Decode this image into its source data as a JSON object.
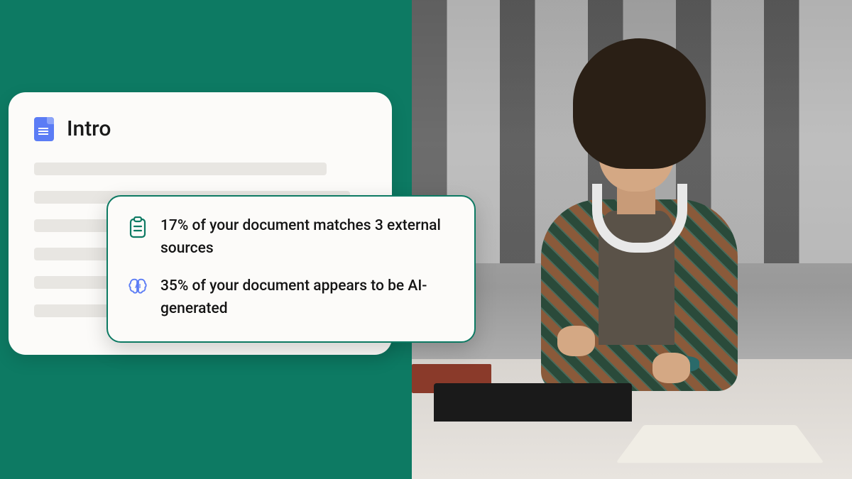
{
  "document": {
    "title": "Intro"
  },
  "report": {
    "plagiarism": {
      "text": "17% of your document matches 3 external sources",
      "percent": 17,
      "source_count": 3
    },
    "ai": {
      "text": "35% of your document appears to be AI-generated",
      "percent": 35
    }
  },
  "colors": {
    "brand_green": "#0d7a63",
    "doc_icon_blue": "#5b7cf5",
    "ai_icon_blue": "#5b7cf5"
  }
}
